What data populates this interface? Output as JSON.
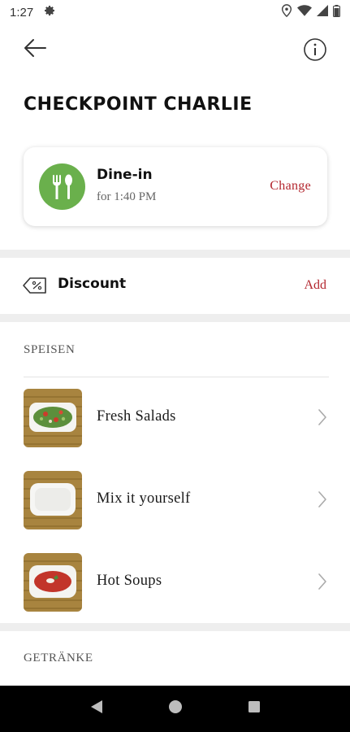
{
  "status_bar": {
    "time": "1:27",
    "icons": [
      "settings-icon",
      "location-icon",
      "wifi-icon",
      "signal-icon",
      "battery-icon"
    ]
  },
  "header": {
    "back_icon": "arrow-left-icon",
    "info_icon": "info-icon"
  },
  "store": {
    "name": "CHECKPOINT CHARLIE"
  },
  "order_type": {
    "mode": "Dine-in",
    "time": "for 1:40 PM",
    "change_label": "Change",
    "icon": "fork-spoon-icon",
    "icon_color": "#6ab04c"
  },
  "discount": {
    "label": "Discount",
    "action_label": "Add",
    "icon": "discount-tag-icon"
  },
  "menu": {
    "sections": [
      {
        "title": "SPEISEN",
        "items": [
          {
            "label": "Fresh Salads",
            "thumb": "salad-bowl-image"
          },
          {
            "label": "Mix it yourself",
            "thumb": "empty-bowl-image"
          },
          {
            "label": "Hot Soups",
            "thumb": "soup-bowl-image"
          }
        ]
      },
      {
        "title": "GETRÄNKE",
        "items": []
      }
    ]
  },
  "colors": {
    "accent": "#b3262e",
    "dine_in_green": "#6ab04c",
    "nav_bar": "#000000"
  },
  "nav_bar": {
    "buttons": [
      "back-triangle-icon",
      "home-circle-icon",
      "recents-square-icon"
    ]
  }
}
